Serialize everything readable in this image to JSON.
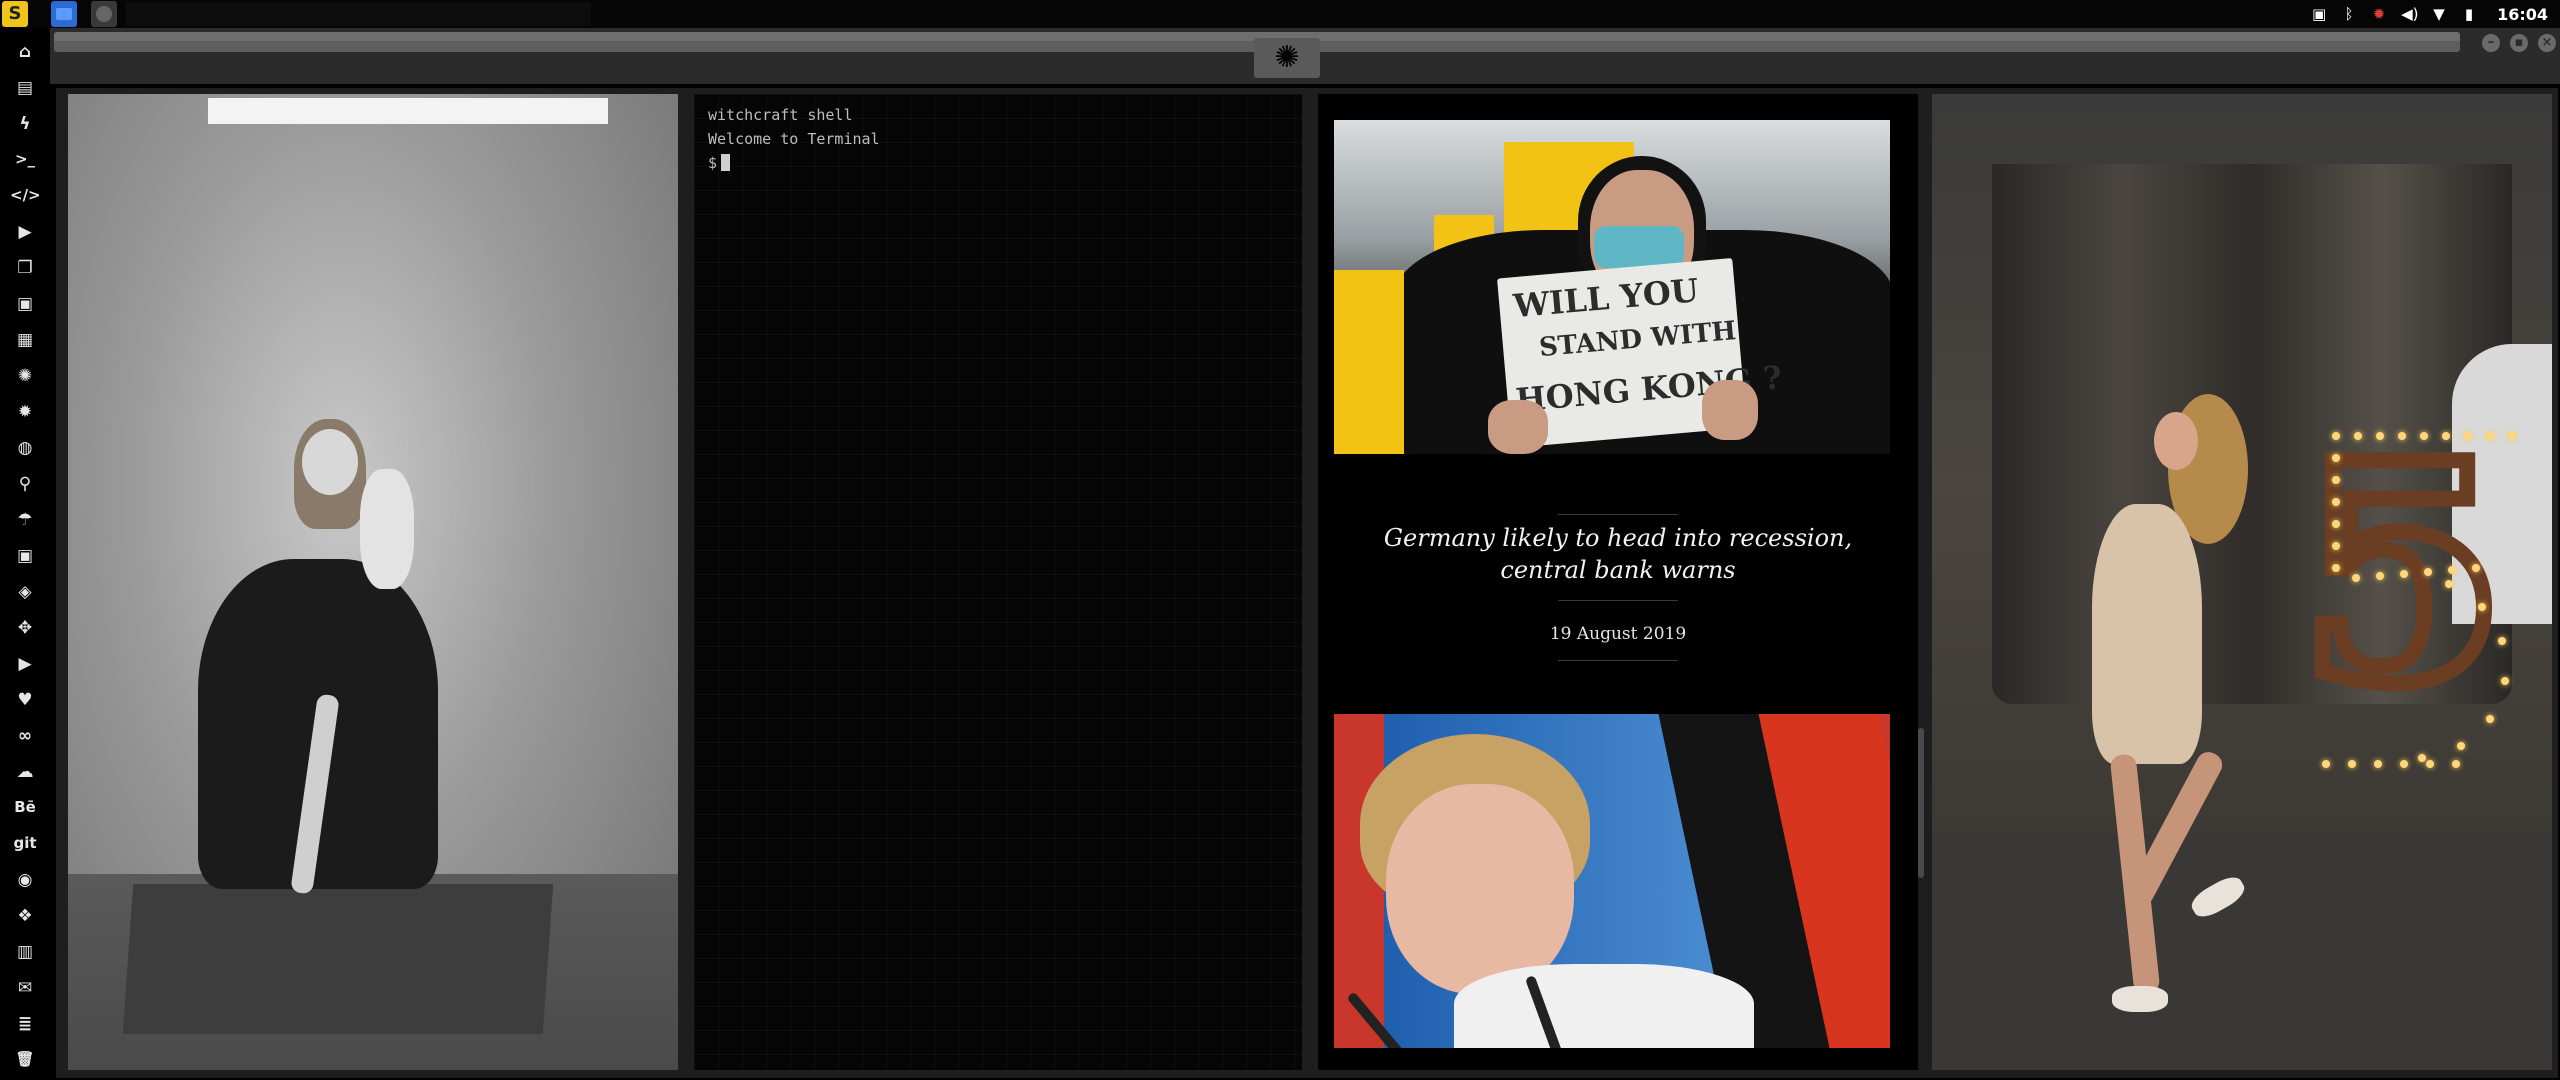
{
  "topbar": {
    "logo_glyph": "S",
    "clock": "16:04",
    "tray_icons": [
      "image-icon",
      "bluetooth-icon",
      "settings-gear-icon",
      "volume-icon",
      "wifi-icon",
      "battery-icon"
    ]
  },
  "sidebar": {
    "items": [
      {
        "name": "home-icon",
        "glyph": "⌂"
      },
      {
        "name": "document-icon",
        "glyph": "▤"
      },
      {
        "name": "lightning-icon",
        "glyph": "ϟ"
      },
      {
        "name": "terminal-icon",
        "glyph": ">_"
      },
      {
        "name": "code-icon",
        "glyph": "</>"
      },
      {
        "name": "play-icon",
        "glyph": "▶"
      },
      {
        "name": "copy-icon",
        "glyph": "❐"
      },
      {
        "name": "image-icon",
        "glyph": "▣"
      },
      {
        "name": "news-icon",
        "glyph": "▦"
      },
      {
        "name": "rebel-icon",
        "glyph": "✺"
      },
      {
        "name": "empire-icon",
        "glyph": "✹"
      },
      {
        "name": "globe-icon",
        "glyph": "◍"
      },
      {
        "name": "search-icon",
        "glyph": "⚲"
      },
      {
        "name": "umbrella-icon",
        "glyph": "☂"
      },
      {
        "name": "contact-icon",
        "glyph": "▣"
      },
      {
        "name": "git-diamond-icon",
        "glyph": "◈"
      },
      {
        "name": "expand-icon",
        "glyph": "✥"
      },
      {
        "name": "youtube-icon",
        "glyph": "▶"
      },
      {
        "name": "heart-icon",
        "glyph": "♥"
      },
      {
        "name": "cc-icon",
        "glyph": "∞"
      },
      {
        "name": "cloud-icon",
        "glyph": "☁"
      },
      {
        "name": "behance-icon",
        "glyph": "Bē"
      },
      {
        "name": "git-icon",
        "glyph": "git"
      },
      {
        "name": "github-icon",
        "glyph": "◉"
      },
      {
        "name": "cubes-icon",
        "glyph": "❖"
      },
      {
        "name": "map-icon",
        "glyph": "▥"
      },
      {
        "name": "mail-icon",
        "glyph": "✉"
      },
      {
        "name": "server-icon",
        "glyph": "≣"
      },
      {
        "name": "trash-icon",
        "glyph": "🗑"
      }
    ]
  },
  "window": {
    "emblem_glyph": "✺",
    "controls": {
      "minimize": "–",
      "maximize": "▪",
      "close": "×"
    }
  },
  "terminal": {
    "line1": "witchcraft shell",
    "line2": "Welcome to Terminal",
    "prompt": "$"
  },
  "news": {
    "sign_lines": [
      "WILL YOU",
      "STAND WITH",
      "HONG KONG ?"
    ],
    "headline": "Germany likely to head into recession, central bank warns",
    "date": "19 August 2019"
  }
}
